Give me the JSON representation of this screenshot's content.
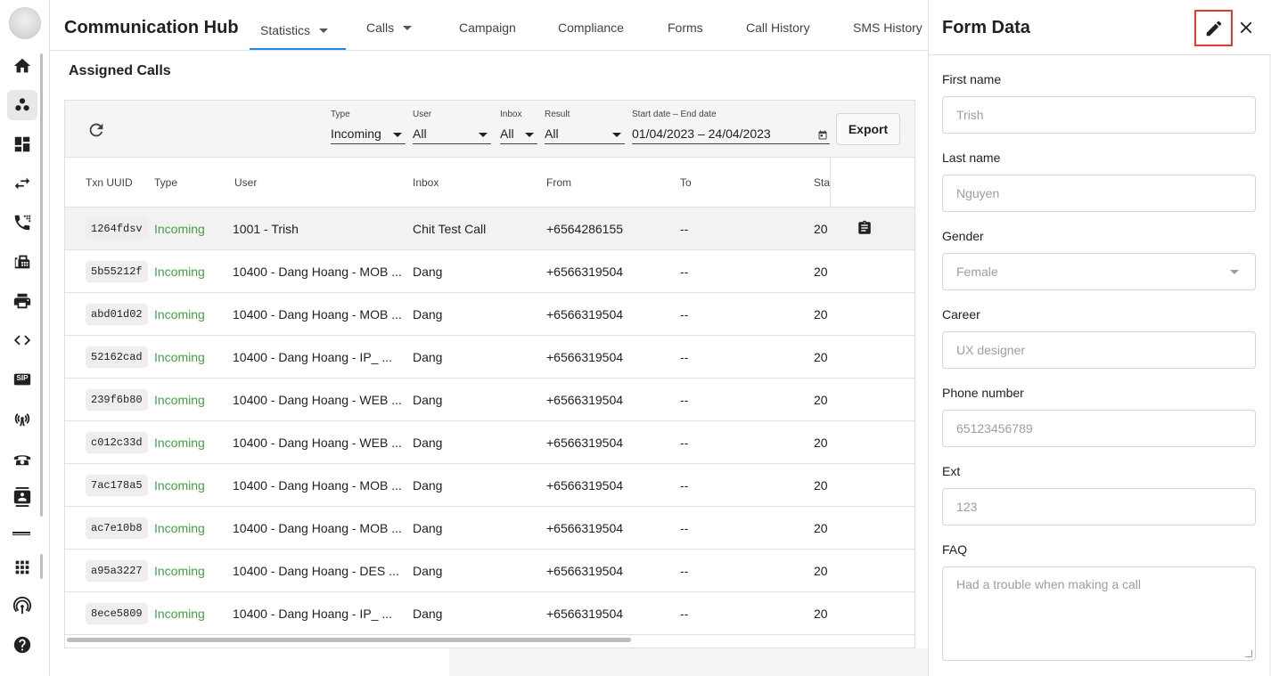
{
  "header": {
    "title": "Communication Hub",
    "tabs": [
      {
        "label": "Statistics",
        "has_dropdown": true,
        "active": true
      },
      {
        "label": "Calls",
        "has_dropdown": true
      },
      {
        "label": "Campaign"
      },
      {
        "label": "Compliance"
      },
      {
        "label": "Forms"
      },
      {
        "label": "Call History"
      },
      {
        "label": "SMS History"
      }
    ]
  },
  "sidebar": {
    "icons": [
      "home-icon",
      "bubbles-icon",
      "dashboard-icon",
      "swap-icon",
      "phone-forward-icon",
      "fax-icon",
      "printer-icon",
      "code-icon",
      "sip-icon",
      "antenna-icon",
      "telephone-icon",
      "contact-card-icon",
      "apps-grid-icon",
      "broadcast-icon",
      "help-icon"
    ],
    "sip_label": "SIP"
  },
  "main": {
    "section_title": "Assigned Calls",
    "filters": {
      "type": {
        "label": "Type",
        "value": "Incoming"
      },
      "user": {
        "label": "User",
        "value": "All"
      },
      "inbox": {
        "label": "Inbox",
        "value": "All"
      },
      "result": {
        "label": "Result",
        "value": "All"
      },
      "date": {
        "label": "Start date – End date",
        "value": "01/04/2023 – 24/04/2023"
      }
    },
    "export_label": "Export",
    "columns": [
      "Txn UUID",
      "Type",
      "User",
      "Inbox",
      "From",
      "To",
      "Sta"
    ],
    "rows": [
      {
        "uuid": "1264fdsv",
        "type": "Incoming",
        "user": "1001 - Trish",
        "inbox": "Chit Test Call",
        "from": "+6564286155",
        "to": "--",
        "start": "20",
        "selected": true
      },
      {
        "uuid": "5b55212f",
        "type": "Incoming",
        "user": "10400 - Dang Hoang - MOB ...",
        "inbox": "Dang",
        "from": "+6566319504",
        "to": "--",
        "start": "20"
      },
      {
        "uuid": "abd01d02",
        "type": "Incoming",
        "user": "10400 - Dang Hoang - MOB ...",
        "inbox": "Dang",
        "from": "+6566319504",
        "to": "--",
        "start": "20"
      },
      {
        "uuid": "52162cad",
        "type": "Incoming",
        "user": "10400 - Dang Hoang - IP_ ...",
        "inbox": "Dang",
        "from": "+6566319504",
        "to": "--",
        "start": "20"
      },
      {
        "uuid": "239f6b80",
        "type": "Incoming",
        "user": "10400 - Dang Hoang - WEB ...",
        "inbox": "Dang",
        "from": "+6566319504",
        "to": "--",
        "start": "20"
      },
      {
        "uuid": "c012c33d",
        "type": "Incoming",
        "user": "10400 - Dang Hoang - WEB ...",
        "inbox": "Dang",
        "from": "+6566319504",
        "to": "--",
        "start": "20"
      },
      {
        "uuid": "7ac178a5",
        "type": "Incoming",
        "user": "10400 - Dang Hoang - MOB ...",
        "inbox": "Dang",
        "from": "+6566319504",
        "to": "--",
        "start": "20"
      },
      {
        "uuid": "ac7e10b8",
        "type": "Incoming",
        "user": "10400 - Dang Hoang - MOB ...",
        "inbox": "Dang",
        "from": "+6566319504",
        "to": "--",
        "start": "20"
      },
      {
        "uuid": "a95a3227",
        "type": "Incoming",
        "user": "10400 - Dang Hoang - DES ...",
        "inbox": "Dang",
        "from": "+6566319504",
        "to": "--",
        "start": "20"
      },
      {
        "uuid": "8ece5809",
        "type": "Incoming",
        "user": "10400 - Dang Hoang - IP_ ...",
        "inbox": "Dang",
        "from": "+6566319504",
        "to": "--",
        "start": "20"
      }
    ]
  },
  "panel": {
    "title": "Form Data",
    "fields": [
      {
        "label": "First name",
        "value": "Trish"
      },
      {
        "label": "Last name",
        "value": "Nguyen"
      },
      {
        "label": "Gender",
        "value": "Female",
        "type": "select"
      },
      {
        "label": "Career",
        "value": "UX designer"
      },
      {
        "label": "Phone number",
        "value": "65123456789"
      },
      {
        "label": "Ext",
        "value": "123"
      },
      {
        "label": "FAQ",
        "value": "Had a trouble when making a call",
        "type": "textarea"
      }
    ]
  },
  "colors": {
    "accent": "#1e88e5",
    "incoming": "#43a047",
    "highlight": "#e53935"
  }
}
